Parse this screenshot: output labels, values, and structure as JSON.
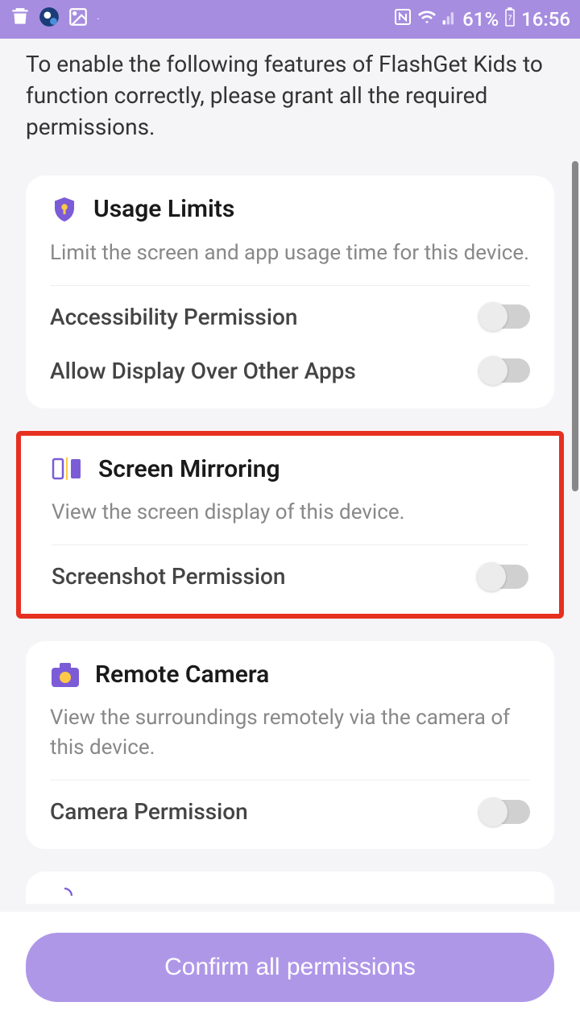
{
  "status_bar": {
    "battery": "61%",
    "time": "16:56"
  },
  "intro": "To enable the following features of FlashGet Kids to function correctly, please grant all the required permissions.",
  "cards": {
    "usage_limits": {
      "title": "Usage Limits",
      "desc": "Limit the screen and app usage time for this device.",
      "perm1": "Accessibility Permission",
      "perm2": "Allow Display Over Other Apps"
    },
    "screen_mirroring": {
      "title": "Screen Mirroring",
      "desc": "View the screen display of this device.",
      "perm1": "Screenshot Permission"
    },
    "remote_camera": {
      "title": "Remote Camera",
      "desc": "View the surroundings remotely via the camera of this device.",
      "perm1": "Camera Permission"
    }
  },
  "confirm_button": "Confirm all permissions"
}
